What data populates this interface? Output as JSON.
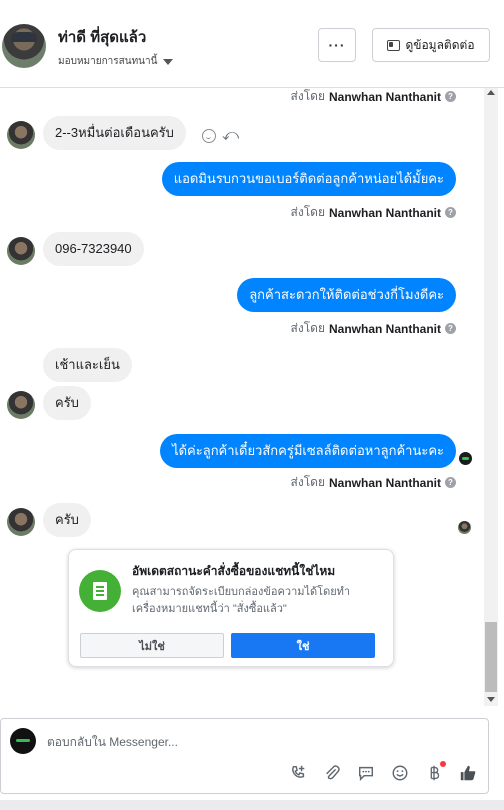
{
  "header": {
    "contact_name": "ท่าดี ที่สุดแล้ว",
    "assign_label": "มอบหมายการสนทนานี้",
    "more_label": "···",
    "info_label": "ดูข้อมูลติดต่อ"
  },
  "sender_name": "Nanwhan Nanthanit",
  "sent_by_prefix": "ส่งโดย",
  "messages": [
    {
      "direction": "in",
      "text": "2--3หมื่นต่อเดือนครับ"
    },
    {
      "direction": "out",
      "text": "แอดมินรบกวนขอเบอร์ติดต่อลูกค้าหน่อยได้มั้ยคะ"
    },
    {
      "direction": "in",
      "text": "096-7323940"
    },
    {
      "direction": "out",
      "text": "ลูกค้าสะดวกให้ติดต่อช่วงกี่โมงดีคะ"
    },
    {
      "direction": "in",
      "text": "เช้าและเย็น"
    },
    {
      "direction": "in",
      "text": "ครับ"
    },
    {
      "direction": "out",
      "text": "ได้ค่ะลูกค้าเดี๋ยวสักครู่มีเซลล์ติดต่อหาลูกค้านะคะ"
    },
    {
      "direction": "in",
      "text": "ครับ"
    }
  ],
  "order_prompt": {
    "title": "อัพเดตสถานะคำสั่งซื้อของแชทนี้ใช่ไหม",
    "description": "คุณสามารถจัดระเบียบกล่องข้อความได้โดยทำเครื่องหมายแชทนี้ว่า \"สั่งซื้อแล้ว\"",
    "no_label": "ไม่ใช่",
    "yes_label": "ใช่"
  },
  "composer": {
    "placeholder": "ตอบกลับใน Messenger..."
  },
  "icons": {
    "tools": [
      "phone-add-icon",
      "attachment-icon",
      "chat-bubble-icon",
      "emoji-icon",
      "baht-icon",
      "thumbs-up-icon"
    ]
  },
  "colors": {
    "outgoing_bubble": "#0084ff",
    "incoming_bubble": "#f0f0f0",
    "primary_button": "#1877f2",
    "prompt_icon": "#44b035"
  }
}
